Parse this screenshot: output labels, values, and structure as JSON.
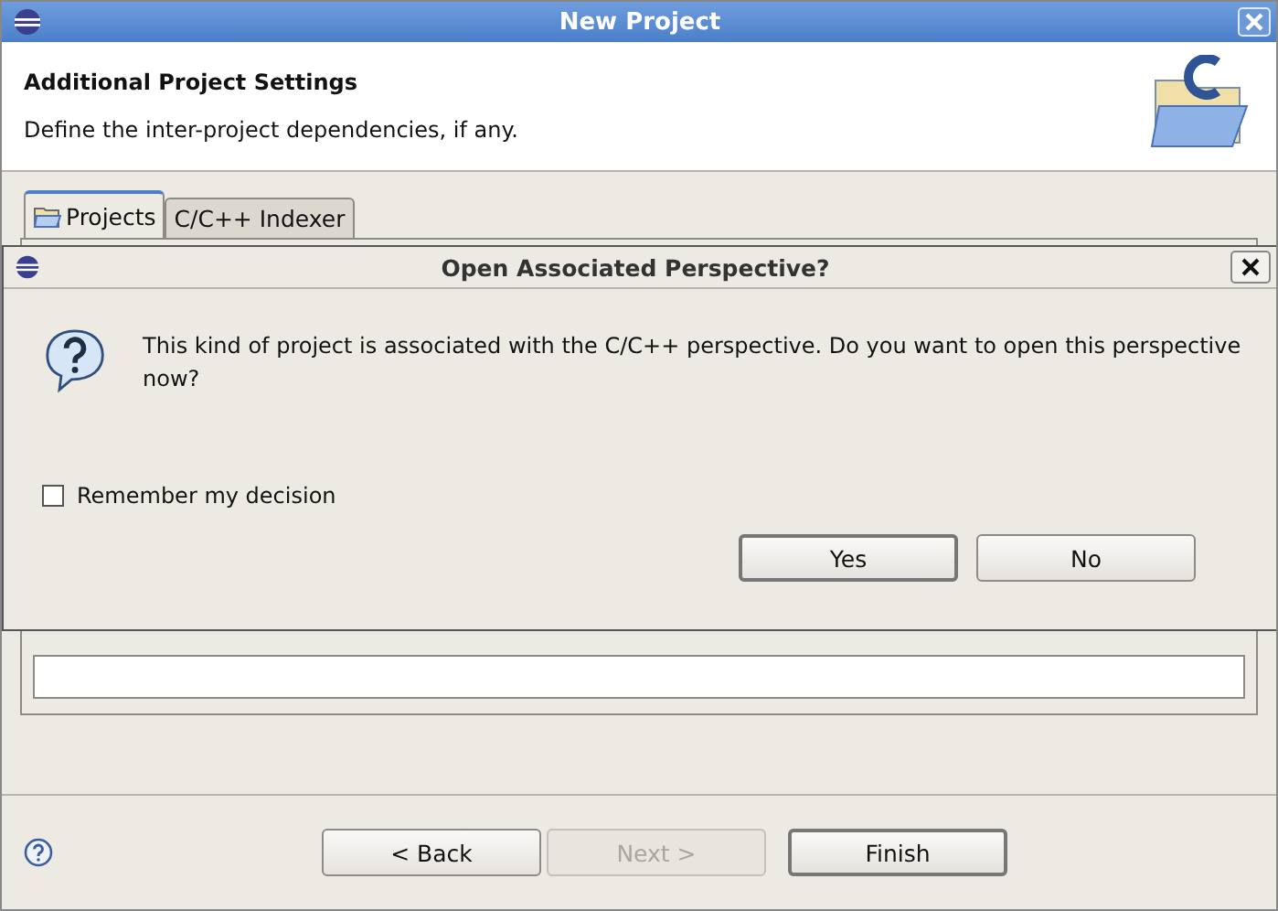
{
  "window": {
    "title": "New Project"
  },
  "header": {
    "title": "Additional Project Settings",
    "description": "Define the inter-project dependencies, if any."
  },
  "tabs": [
    {
      "label": "Projects",
      "selected": true,
      "kind": "folder"
    },
    {
      "label": "C/C++ Indexer",
      "selected": false,
      "kind": "plain"
    }
  ],
  "buttons": [
    {
      "label": "< Back",
      "disabled": false,
      "default": false
    },
    {
      "label": "Next >",
      "disabled": true,
      "default": false
    },
    {
      "label": "Finish",
      "disabled": false,
      "default": true
    }
  ],
  "dialog": {
    "title": "Open Associated Perspective?",
    "message": "This kind of project is associated with the C/C++ perspective.  Do you want to open this perspective now?",
    "checkbox": {
      "label": "Remember my decision",
      "checked": false
    },
    "buttons": [
      {
        "label": "Yes",
        "default": true
      },
      {
        "label": "No",
        "default": false
      }
    ]
  }
}
